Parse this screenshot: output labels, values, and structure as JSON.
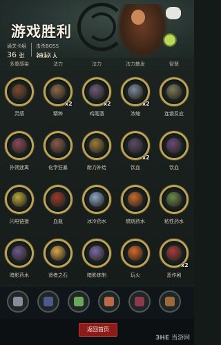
{
  "header": {
    "title": "游戏胜利",
    "stats": [
      {
        "label": "通关卡组",
        "value": "36",
        "unit": "张"
      },
      {
        "label": "击杀BOSS",
        "value": "神秘人",
        "unit": ""
      }
    ]
  },
  "top_row_labels": [
    "多重感染",
    "法力",
    "法力",
    "法力散发",
    "智慧"
  ],
  "cards": [
    {
      "name": "灵感",
      "multiplier": "",
      "color": "#7a4a2e"
    },
    {
      "name": "精粹",
      "multiplier": "x2",
      "color": "#8a6a4a"
    },
    {
      "name": "鸡尾酒",
      "multiplier": "x2",
      "color": "#6a5a7a"
    },
    {
      "name": "浓缩",
      "multiplier": "x2",
      "color": "#7a8a9a"
    },
    {
      "name": "连锁反应",
      "multiplier": "",
      "color": "#7a7a5a"
    },
    {
      "name": "扑朔迷离",
      "multiplier": "",
      "color": "#8a4a5a"
    },
    {
      "name": "化学狂暴",
      "multiplier": "",
      "color": "#8a5a4a"
    },
    {
      "name": "耐力补给",
      "multiplier": "",
      "color": "#9a7a3a"
    },
    {
      "name": "饮血",
      "multiplier": "x2",
      "color": "#5a4a6a"
    },
    {
      "name": "饮血",
      "multiplier": "",
      "color": "#6a4a7a"
    },
    {
      "name": "闪电链接",
      "multiplier": "",
      "color": "#b8a63a"
    },
    {
      "name": "血瓶",
      "multiplier": "",
      "color": "#9a3a2a"
    },
    {
      "name": "冰冷药水",
      "multiplier": "",
      "color": "#8aa8c8"
    },
    {
      "name": "燃烧药水",
      "multiplier": "",
      "color": "#c86a2a"
    },
    {
      "name": "粘性药水",
      "multiplier": "",
      "color": "#6a8a4a"
    },
    {
      "name": "暗影药水",
      "multiplier": "",
      "color": "#6a5a8a"
    },
    {
      "name": "贤者之石",
      "multiplier": "",
      "color": "#d8a84a"
    },
    {
      "name": "暗影炼制",
      "multiplier": "",
      "color": "#7a6aa8"
    },
    {
      "name": "玩火",
      "multiplier": "",
      "color": "#d8682a"
    },
    {
      "name": "恶作剧",
      "multiplier": "x2",
      "color": "#a83a3a"
    }
  ],
  "bottom_items": [
    {
      "icon": "relic-scroll-icon",
      "color": "#8a8a9a"
    },
    {
      "icon": "relic-tome-icon",
      "color": "#4a5a8a"
    },
    {
      "icon": "relic-flask-icon",
      "color": "#6aa85a"
    },
    {
      "icon": "relic-mask-icon",
      "color": "#b86a4a"
    },
    {
      "icon": "relic-card-icon",
      "color": "#8a3a4a"
    },
    {
      "icon": "relic-owl-icon",
      "color": "#9a6a3a"
    }
  ],
  "footer": {
    "return_label": "返回首页",
    "watermark_brand": "3HE",
    "watermark_site": "当游网"
  }
}
